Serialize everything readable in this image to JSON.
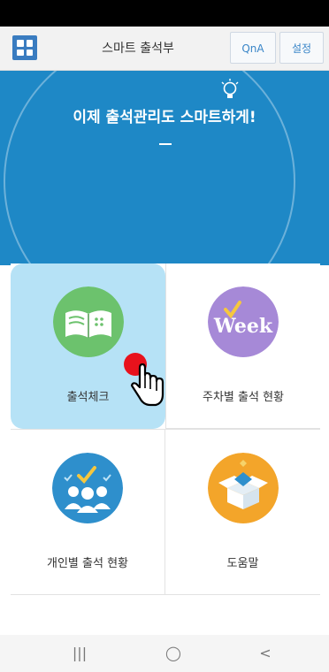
{
  "header": {
    "title": "스마트 출석부",
    "qna_label": "QnA",
    "settings_label": "설정"
  },
  "hero": {
    "headline": "이제 출석관리도 스마트하게!"
  },
  "menu": {
    "items": [
      {
        "label": "출석체크",
        "icon": "open-book-icon",
        "color": "#6cc26d"
      },
      {
        "label": "주차별 출석 현황",
        "icon": "week-badge-icon",
        "color": "#a689d7"
      },
      {
        "label": "개인별 출석 현황",
        "icon": "people-check-icon",
        "color": "#2e8fcc"
      },
      {
        "label": "도움말",
        "icon": "open-box-icon",
        "color": "#f3a52a"
      }
    ]
  },
  "navbar": {
    "recent": "|||",
    "home": "◯",
    "back": "<"
  }
}
